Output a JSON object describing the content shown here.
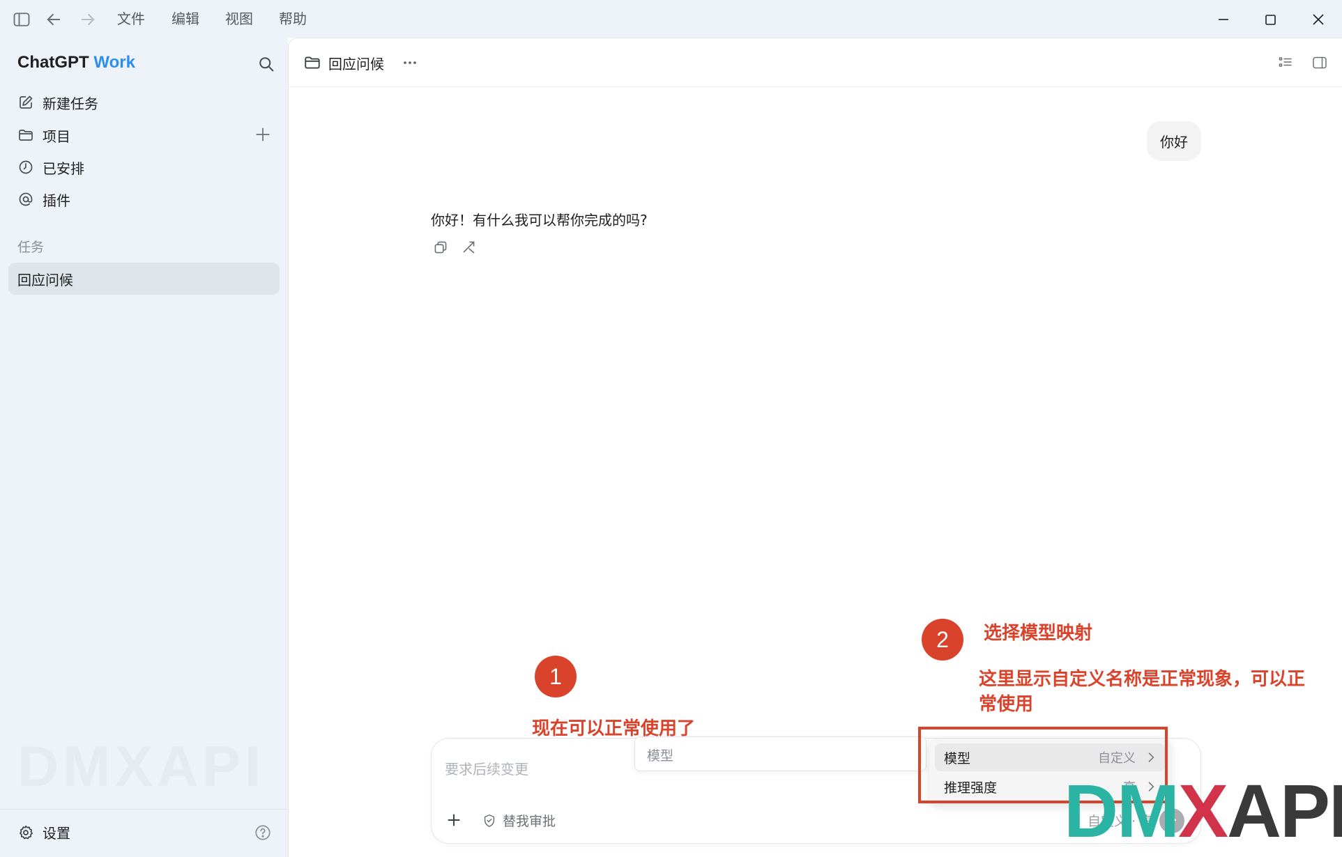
{
  "menu": {
    "items": [
      "文件",
      "编辑",
      "视图",
      "帮助"
    ]
  },
  "sidebar": {
    "brand_main": "ChatGPT",
    "brand_accent": "Work",
    "nav": [
      {
        "label": "新建任务",
        "icon": "edit-icon"
      },
      {
        "label": "项目",
        "icon": "folder-icon"
      },
      {
        "label": "已安排",
        "icon": "clock-icon"
      },
      {
        "label": "插件",
        "icon": "at-icon"
      }
    ],
    "section_label": "任务",
    "tasks": [
      "回应问候"
    ],
    "watermark": "DMXAPI",
    "settings_label": "设置"
  },
  "main": {
    "header_title": "回应问候",
    "user_message": "你好",
    "assistant_message": "你好！有什么我可以帮你完成的吗?"
  },
  "composer": {
    "placeholder": "要求后续变更",
    "approve_label": "替我审批",
    "model_label": "自定义 · 高",
    "model_field_label": "模型"
  },
  "dropdown": {
    "items": [
      {
        "label": "模型",
        "value": "自定义"
      },
      {
        "label": "推理强度",
        "value": "高"
      }
    ]
  },
  "annotations": {
    "circle1": "1",
    "circle2": "2",
    "note1": "现在可以正常使用了",
    "note2_title": "选择模型映射",
    "note2_line1": "这里显示自定义名称是正常现象，可以正",
    "note2_line2": "常使用",
    "accent_color": "#d9432b"
  },
  "logo": {
    "part1": "DM",
    "part2": "X",
    "part3": "API"
  }
}
